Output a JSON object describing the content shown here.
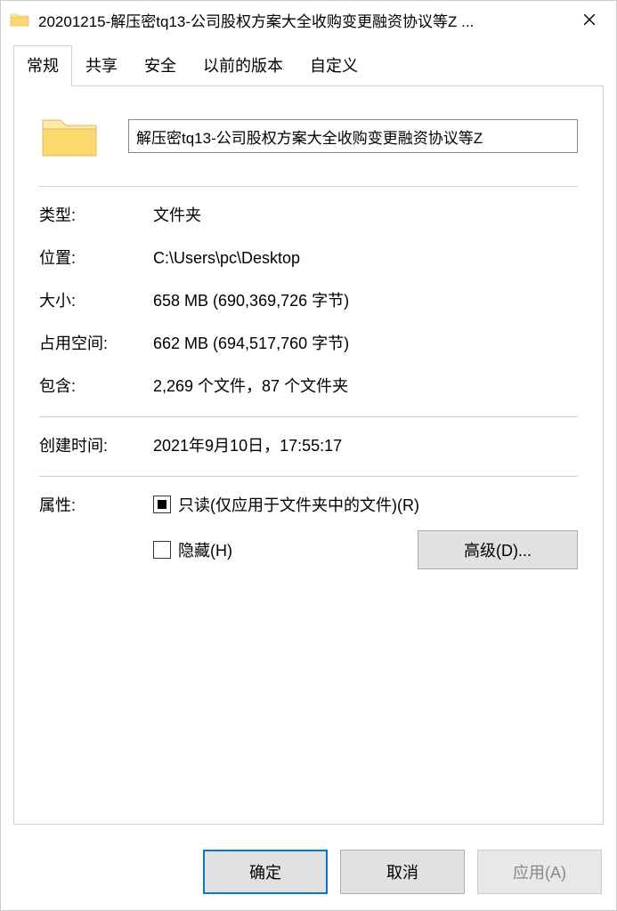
{
  "titlebar": {
    "title": "20201215-解压密tq13-公司股权方案大全收购变更融资协议等Z ..."
  },
  "tabs": {
    "general": "常规",
    "sharing": "共享",
    "security": "安全",
    "previous": "以前的版本",
    "customize": "自定义"
  },
  "folder_name": "解压密tq13-公司股权方案大全收购变更融资协议等Z",
  "fields": {
    "type_label": "类型:",
    "type_value": "文件夹",
    "location_label": "位置:",
    "location_value": "C:\\Users\\pc\\Desktop",
    "size_label": "大小:",
    "size_value": "658 MB (690,369,726 字节)",
    "size_on_disk_label": "占用空间:",
    "size_on_disk_value": "662 MB (694,517,760 字节)",
    "contains_label": "包含:",
    "contains_value": "2,269 个文件，87 个文件夹",
    "created_label": "创建时间:",
    "created_value": "2021年9月10日，17:55:17",
    "attributes_label": "属性:",
    "readonly_label": "只读(仅应用于文件夹中的文件)(R)",
    "hidden_label": "隐藏(H)",
    "advanced_btn": "高级(D)..."
  },
  "buttons": {
    "ok": "确定",
    "cancel": "取消",
    "apply": "应用(A)"
  }
}
